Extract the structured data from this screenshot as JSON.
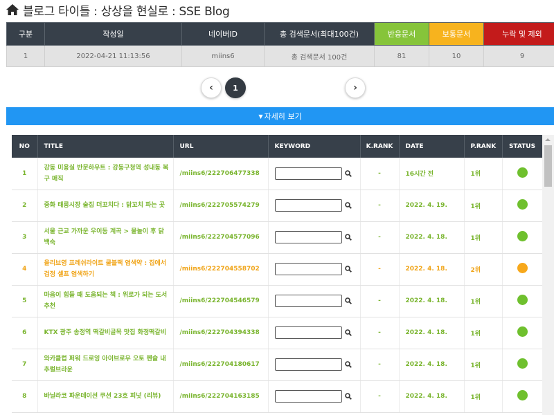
{
  "header": {
    "title": "블로그 타이틀 : 상상을 현실로 : SSE Blog",
    "icon": "home-icon"
  },
  "summary": {
    "columns": [
      "구분",
      "작성일",
      "네이버ID",
      "총 검색문서(최대100건)",
      "반응문서",
      "보통문서",
      "누락 및 제외"
    ],
    "row": [
      "1",
      "2022-04-21 11:13:56",
      "miins6",
      "총 검색문서 100건",
      "81",
      "10",
      "9"
    ],
    "colors": {
      "header": "#37404a",
      "reactive": "#86c43a",
      "normal": "#f7b31e",
      "missing": "#c31b1b"
    }
  },
  "pager": {
    "prev": "‹",
    "current": "1",
    "next": "›"
  },
  "detail": {
    "label": "자세히 보기"
  },
  "results": {
    "columns": [
      "NO",
      "TITLE",
      "URL",
      "KEYWORD",
      "K.RANK",
      "DATE",
      "P.RANK",
      "STATUS"
    ],
    "rows": [
      {
        "no": "1",
        "title": "강동 미용실 반문하우트 : 강동구청역 성내동 복구 매직",
        "url": "/miins6/222706477338",
        "krank": "-",
        "date": "16시간 전",
        "prank": "1위",
        "status": "green"
      },
      {
        "no": "2",
        "title": "중화 태릉시장 술집 더꼬치다 : 닭꼬치 파는 곳",
        "url": "/miins6/222705574279",
        "krank": "-",
        "date": "2022. 4. 19.",
        "prank": "1위",
        "status": "green"
      },
      {
        "no": "3",
        "title": "서울 근교 가까운 우이동 계곡 > 물놀이 후 닭백숙",
        "url": "/miins6/222704577096",
        "krank": "-",
        "date": "2022. 4. 18.",
        "prank": "1위",
        "status": "green"
      },
      {
        "no": "4",
        "title": "올리브영 프레쉬라이트 쿨블랙 염색약 : 집에서 검정 셀프 염색하기",
        "url": "/miins6/222704558702",
        "krank": "-",
        "date": "2022. 4. 18.",
        "prank": "2위",
        "status": "orange"
      },
      {
        "no": "5",
        "title": "마음이 힘들 때 도움되는 책 : 위로가 되는 도서 추천",
        "url": "/miins6/222704546579",
        "krank": "-",
        "date": "2022. 4. 18.",
        "prank": "1위",
        "status": "green"
      },
      {
        "no": "6",
        "title": "KTX 광주 송정역 떡갈비골목 맛집 화정떡갈비",
        "url": "/miins6/222704394338",
        "krank": "-",
        "date": "2022. 4. 18.",
        "prank": "1위",
        "status": "green"
      },
      {
        "no": "7",
        "title": "와카클럽 퍼워 드로잉 아이브로우 오토 펜슬 내추럴브라운",
        "url": "/miins6/222704180617",
        "krank": "-",
        "date": "2022. 4. 18.",
        "prank": "1위",
        "status": "green"
      },
      {
        "no": "8",
        "title": "바닐라코 파운데이션 쿠션 23호 피넛 (리뷰)",
        "url": "/miins6/222704163185",
        "krank": "-",
        "date": "2022. 4. 18.",
        "prank": "1위",
        "status": "green"
      }
    ],
    "status_colors": {
      "green": "#6fc02e",
      "orange": "#f7a81b"
    },
    "text_colors": {
      "normal": "#7ab52f",
      "warn": "#f0a51a"
    }
  }
}
